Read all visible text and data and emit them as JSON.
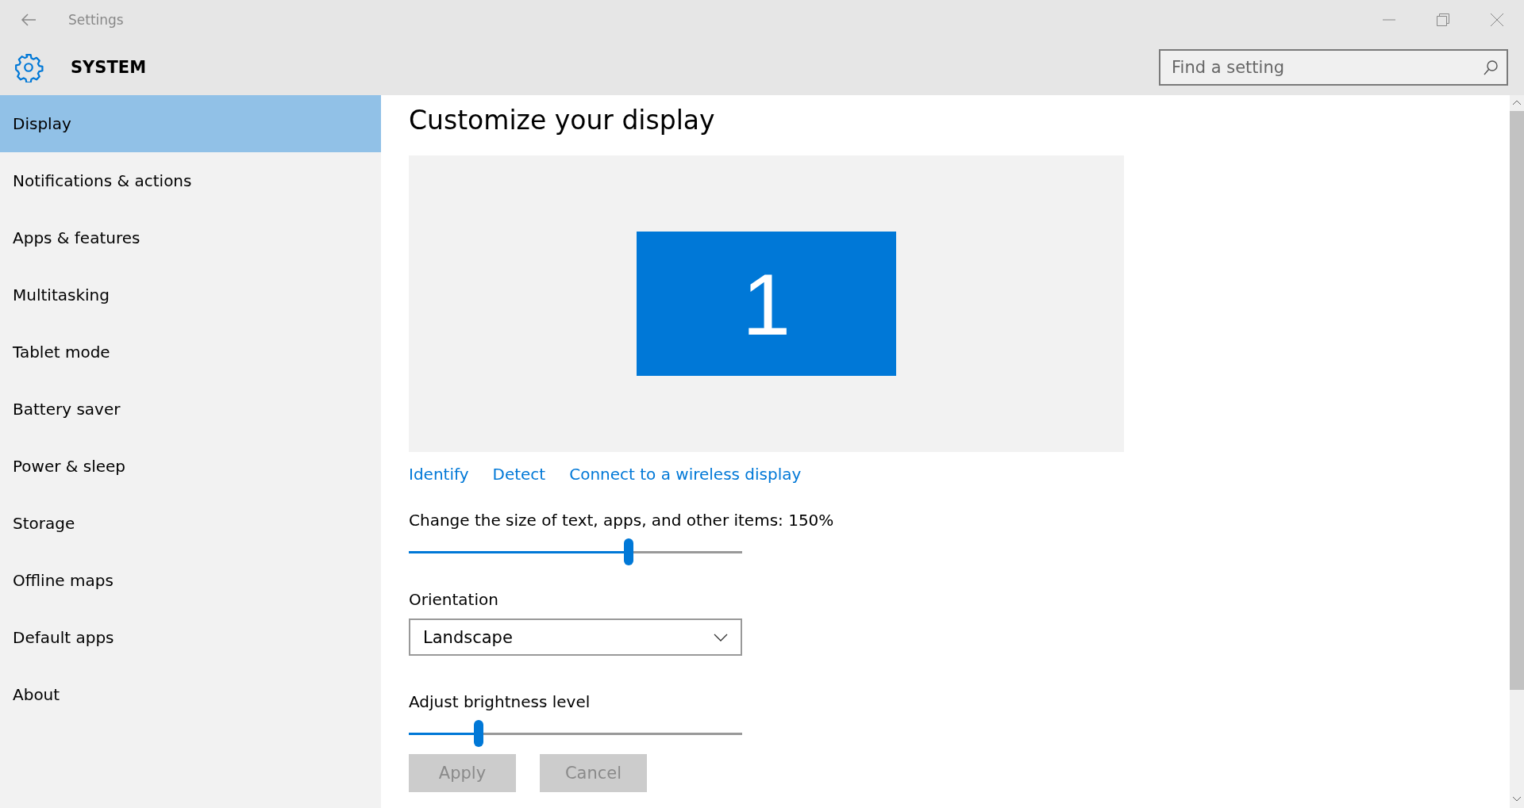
{
  "window": {
    "title": "Settings"
  },
  "header": {
    "title": "SYSTEM"
  },
  "search": {
    "placeholder": "Find a setting"
  },
  "sidebar": {
    "items": [
      {
        "label": "Display",
        "selected": true
      },
      {
        "label": "Notifications & actions",
        "selected": false
      },
      {
        "label": "Apps & features",
        "selected": false
      },
      {
        "label": "Multitasking",
        "selected": false
      },
      {
        "label": "Tablet mode",
        "selected": false
      },
      {
        "label": "Battery saver",
        "selected": false
      },
      {
        "label": "Power & sleep",
        "selected": false
      },
      {
        "label": "Storage",
        "selected": false
      },
      {
        "label": "Offline maps",
        "selected": false
      },
      {
        "label": "Default apps",
        "selected": false
      },
      {
        "label": "About",
        "selected": false
      }
    ]
  },
  "content": {
    "heading": "Customize your display",
    "monitor": {
      "label": "1"
    },
    "links": [
      "Identify",
      "Detect",
      "Connect to a wireless display"
    ],
    "scale": {
      "label": "Change the size of text, apps, and other items: 150%",
      "level": 0.66
    },
    "orientation": {
      "label": "Orientation",
      "value": "Landscape"
    },
    "brightness": {
      "label": "Adjust brightness level",
      "level": 0.21
    },
    "buttons": [
      {
        "label": "Apply",
        "disabled": true
      },
      {
        "label": "Cancel",
        "disabled": true
      }
    ]
  }
}
